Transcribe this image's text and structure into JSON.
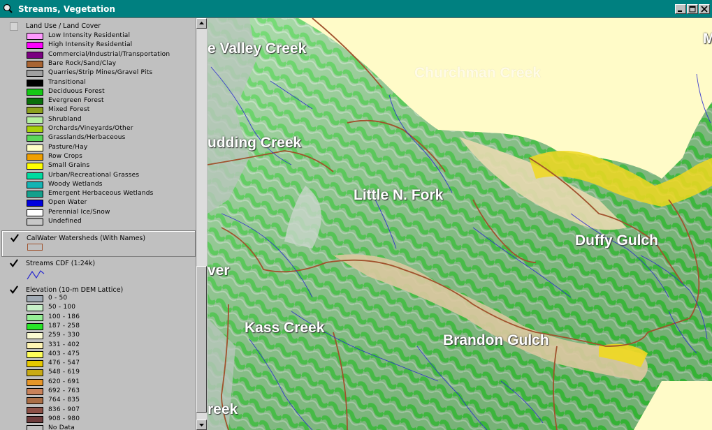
{
  "window": {
    "title": "Streams, Vegetation",
    "title_bar_color": "#008080",
    "controls": [
      "minimize-icon",
      "maximize-icon",
      "close-icon"
    ]
  },
  "legend": {
    "land_use": {
      "title": "Land Use / Land Cover",
      "checked": false,
      "classes": [
        {
          "label": "Low Intensity Residential",
          "color": "#ff99ff"
        },
        {
          "label": "High Intensity Residential",
          "color": "#ff00ff"
        },
        {
          "label": "Commercial/Industrial/Transportation",
          "color": "#7a0080"
        },
        {
          "label": "Bare Rock/Sand/Clay",
          "color": "#a86432"
        },
        {
          "label": "Quarries/Strip Mines/Gravel Pits",
          "color": "#a0a0a0"
        },
        {
          "label": "Transitional",
          "color": "#000000"
        },
        {
          "label": "Deciduous Forest",
          "color": "#14c814"
        },
        {
          "label": "Evergreen Forest",
          "color": "#0a6e0a"
        },
        {
          "label": "Mixed Forest",
          "color": "#8ca01e"
        },
        {
          "label": "Shrubland",
          "color": "#b4f0a0"
        },
        {
          "label": "Orchards/Vineyards/Other",
          "color": "#a8d20a"
        },
        {
          "label": "Grasslands/Herbaceous",
          "color": "#5ad75a"
        },
        {
          "label": "Pasture/Hay",
          "color": "#ffffc8"
        },
        {
          "label": "Row Crops",
          "color": "#f0a000"
        },
        {
          "label": "Small Grains",
          "color": "#ffff00"
        },
        {
          "label": "Urban/Recreational Grasses",
          "color": "#00dca0"
        },
        {
          "label": "Woody Wetlands",
          "color": "#14b4b4"
        },
        {
          "label": "Emergent Herbaceous Wetlands",
          "color": "#14a08c"
        },
        {
          "label": "Open Water",
          "color": "#0000dc"
        },
        {
          "label": "Perennial Ice/Snow",
          "color": "#ffffff"
        },
        {
          "label": "Undefined",
          "color": "#c8c8c8"
        }
      ]
    },
    "watersheds": {
      "title": "CalWater Watersheds (With Names)",
      "checked": true,
      "symbol_color": "#a0522d"
    },
    "streams": {
      "title": "Streams CDF (1:24k)",
      "checked": true,
      "symbol_color": "#2a2ad0"
    },
    "elevation": {
      "title": "Elevation (10-m DEM Lattice)",
      "checked": true,
      "classes": [
        {
          "label": "0 - 50",
          "color": "#a0aab4"
        },
        {
          "label": "50 - 100",
          "color": "#c8f0c8"
        },
        {
          "label": "100 - 186",
          "color": "#96f096"
        },
        {
          "label": "187 - 258",
          "color": "#28e628"
        },
        {
          "label": "259 - 330",
          "color": "#fafad2"
        },
        {
          "label": "331 - 402",
          "color": "#fff5b4"
        },
        {
          "label": "403 - 475",
          "color": "#ffff5a"
        },
        {
          "label": "476 - 547",
          "color": "#e6c800"
        },
        {
          "label": "548 - 619",
          "color": "#c8aa14"
        },
        {
          "label": "620 - 691",
          "color": "#e69628"
        },
        {
          "label": "692 - 763",
          "color": "#c8825a"
        },
        {
          "label": "764 - 835",
          "color": "#aa6e46"
        },
        {
          "label": "836 - 907",
          "color": "#8c5046"
        },
        {
          "label": "908 - 980",
          "color": "#6e3c3c"
        },
        {
          "label": "No Data",
          "color": "#c0c0c0"
        }
      ]
    }
  },
  "map": {
    "labels": [
      {
        "text": "e Valley Creek",
        "style": "normal"
      },
      {
        "text": "Churchman Creek",
        "style": "faint"
      },
      {
        "text": "udding Creek",
        "style": "normal"
      },
      {
        "text": "Little N. Fork",
        "style": "normal"
      },
      {
        "text": "Duffy Gulch",
        "style": "normal"
      },
      {
        "text": "ver",
        "style": "normal"
      },
      {
        "text": "Kass Creek",
        "style": "normal"
      },
      {
        "text": "Brandon Gulch",
        "style": "normal"
      },
      {
        "text": "reek",
        "style": "normal"
      },
      {
        "text": "M",
        "style": "normal"
      }
    ]
  }
}
